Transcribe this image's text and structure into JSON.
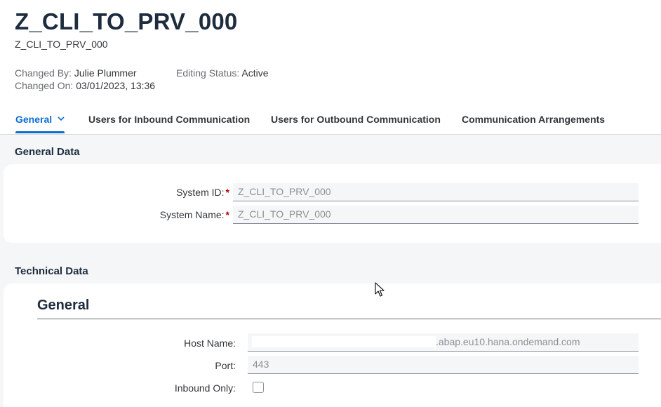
{
  "header": {
    "title": "Z_CLI_TO_PRV_000",
    "subtitle": "Z_CLI_TO_PRV_000",
    "changed_by_label": "Changed By:",
    "changed_by_value": "Julie Plummer",
    "changed_on_label": "Changed On:",
    "changed_on_value": "03/01/2023, 13:36",
    "editing_status_label": "Editing Status:",
    "editing_status_value": "Active"
  },
  "tabs": [
    {
      "label": "General",
      "active": true,
      "icon": "chevron-down-icon"
    },
    {
      "label": "Users for Inbound Communication"
    },
    {
      "label": "Users for Outbound Communication"
    },
    {
      "label": "Communication Arrangements"
    }
  ],
  "general_data": {
    "title": "General Data",
    "system_id_label": "System ID:",
    "system_id_value": "Z_CLI_TO_PRV_000",
    "system_name_label": "System Name:",
    "system_name_value": "Z_CLI_TO_PRV_000",
    "required_mark": "*"
  },
  "technical_data": {
    "title": "Technical Data",
    "subsection_title": "General",
    "host_name_label": "Host Name:",
    "host_name_value": ".abap.eu10.hana.ondemand.com",
    "port_label": "Port:",
    "port_value": "443",
    "inbound_only_label": "Inbound Only:",
    "inbound_only_checked": false
  },
  "colors": {
    "accent": "#0a6ed1",
    "required": "#bb0000",
    "title": "#1d2d3e"
  }
}
